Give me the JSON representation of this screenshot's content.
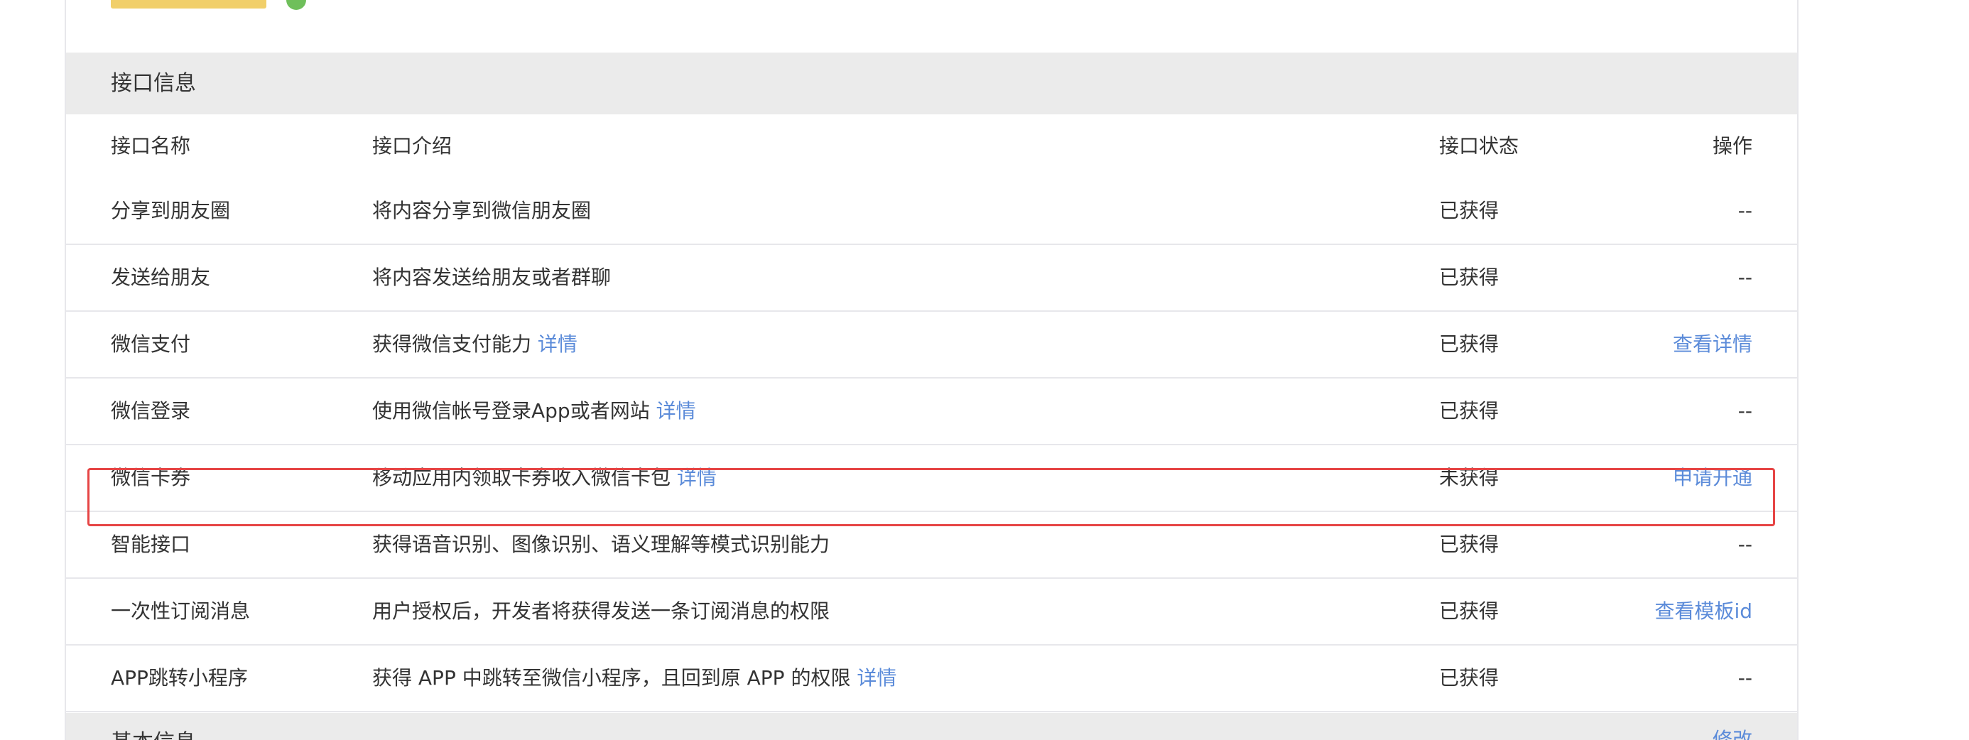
{
  "section": {
    "title": "接口信息"
  },
  "table": {
    "headers": {
      "name": "接口名称",
      "desc": "接口介绍",
      "status": "接口状态",
      "op": "操作"
    },
    "rows": [
      {
        "name": "分享到朋友圈",
        "desc": "将内容分享到微信朋友圈",
        "desc_link": "",
        "status": "已获得",
        "op": "--",
        "op_is_link": false
      },
      {
        "name": "发送给朋友",
        "desc": "将内容发送给朋友或者群聊",
        "desc_link": "",
        "status": "已获得",
        "op": "--",
        "op_is_link": false
      },
      {
        "name": "微信支付",
        "desc": "获得微信支付能力",
        "desc_link": "详情",
        "status": "已获得",
        "op": "查看详情",
        "op_is_link": true
      },
      {
        "name": "微信登录",
        "desc": "使用微信帐号登录App或者网站",
        "desc_link": "详情",
        "status": "已获得",
        "op": "--",
        "op_is_link": false
      },
      {
        "name": "微信卡券",
        "desc": "移动应用内领取卡券收入微信卡包",
        "desc_link": "详情",
        "status": "未获得",
        "op": "申请开通",
        "op_is_link": true
      },
      {
        "name": "智能接口",
        "desc": "获得语音识别、图像识别、语义理解等模式识别能力",
        "desc_link": "",
        "status": "已获得",
        "op": "--",
        "op_is_link": false
      },
      {
        "name": "一次性订阅消息",
        "desc": "用户授权后，开发者将获得发送一条订阅消息的权限",
        "desc_link": "",
        "status": "已获得",
        "op": "查看模板id",
        "op_is_link": true
      },
      {
        "name": "APP跳转小程序",
        "desc": "获得 APP 中跳转至微信小程序，且回到原 APP 的权限",
        "desc_link": "详情",
        "status": "已获得",
        "op": "--",
        "op_is_link": false
      }
    ]
  },
  "next_section": {
    "title": "基本信息",
    "link": "修改"
  },
  "colors": {
    "link": "#5b8bd9",
    "highlight": "#e64545",
    "header_bg": "#ebebeb"
  }
}
